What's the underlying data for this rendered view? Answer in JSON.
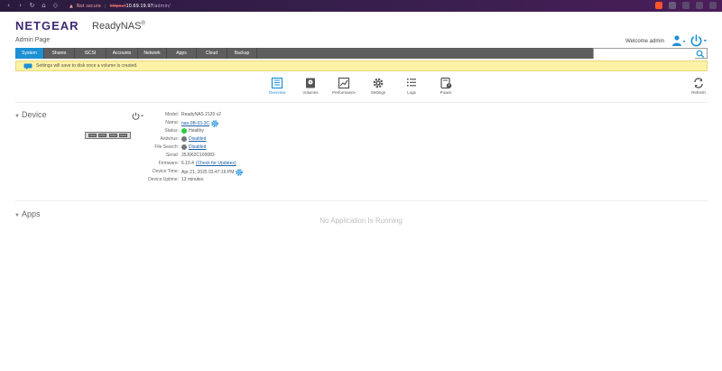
{
  "browser": {
    "security_label": "Not secure",
    "url_protocol": "https://",
    "url_host": "10.69.19.97",
    "url_path": "/admin/"
  },
  "header": {
    "brand": "NETGEAR",
    "product": "ReadyNAS",
    "product_mark": "®",
    "subtitle": "Admin Page",
    "welcome": "Welcome admin"
  },
  "tabs": [
    {
      "label": "System",
      "active": true
    },
    {
      "label": "Shares",
      "active": false
    },
    {
      "label": "iSCSI",
      "active": false
    },
    {
      "label": "Accounts",
      "active": false
    },
    {
      "label": "Network",
      "active": false
    },
    {
      "label": "Apps",
      "active": false
    },
    {
      "label": "Cloud",
      "active": false
    },
    {
      "label": "Backup",
      "active": false
    }
  ],
  "search": {
    "placeholder": ""
  },
  "notice": {
    "text": "Settings will save to disk once a volume is created."
  },
  "toolbar": {
    "items": [
      {
        "label": "Overview",
        "icon": "overview-icon",
        "active": true
      },
      {
        "label": "Volumes",
        "icon": "volumes-icon",
        "active": false
      },
      {
        "label": "Performance",
        "icon": "performance-icon",
        "active": false
      },
      {
        "label": "Settings",
        "icon": "settings-icon",
        "active": false
      },
      {
        "label": "Logs",
        "icon": "logs-icon",
        "active": false
      },
      {
        "label": "Power",
        "icon": "power-icon",
        "active": false
      }
    ],
    "refresh_label": "Refresh"
  },
  "device": {
    "section_title": "Device",
    "properties": [
      {
        "key": "Model:",
        "value": "ReadyNAS 2120 v2"
      },
      {
        "key": "Name:",
        "value": "nas-0B-03-3C",
        "link": true,
        "gear": true
      },
      {
        "key": "Status:",
        "value": "Healthy",
        "dot": "#2ecc40"
      },
      {
        "key": "Antivirus:",
        "value": "Disabled",
        "link": true,
        "dot": "#777777"
      },
      {
        "key": "File Search:",
        "value": "Disabled",
        "link": true,
        "dot": "#777777"
      },
      {
        "key": "Serial:",
        "value": "35J962C100083"
      },
      {
        "key": "Firmware:",
        "value": "6.10.4",
        "extra": "(Check for Updates)"
      },
      {
        "key": "Device Time:",
        "value": "Apr 21, 2025 03:47:16 PM",
        "gear": true
      },
      {
        "key": "Device Uptime:",
        "value": "13 minutes"
      }
    ]
  },
  "apps": {
    "section_title": "Apps",
    "empty_text": "No Application Is Running"
  },
  "colors": {
    "brand": "#3d2a73",
    "accent": "#1e90d4",
    "tabbar": "#5e5e5e",
    "notice_bg": "#fdf2a6"
  }
}
